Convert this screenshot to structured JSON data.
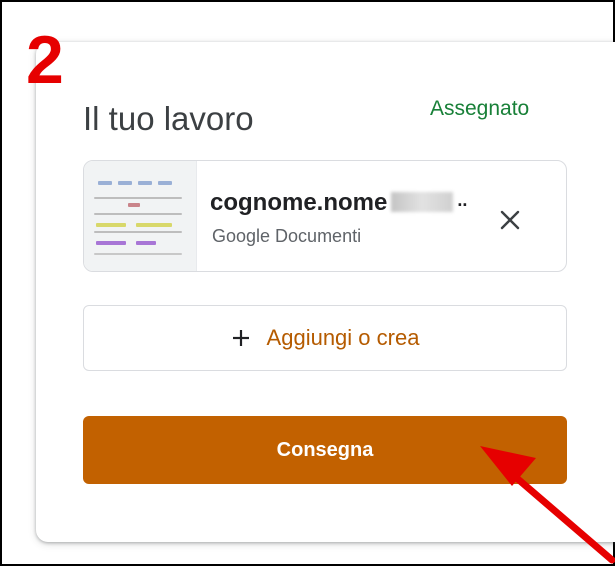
{
  "step": {
    "number": "2"
  },
  "card": {
    "title": "Il tuo lavoro",
    "status": "Assegnato"
  },
  "attachment": {
    "file_name": "cognome.nome",
    "file_type": "Google Documenti",
    "thumbnail_icon": "document-thumbnail",
    "remove_icon": "close-icon"
  },
  "actions": {
    "add_label": "Aggiungi o crea",
    "add_icon": "plus-icon",
    "submit_label": "Consegna"
  },
  "colors": {
    "step_number": "#e60000",
    "status": "#188038",
    "accent": "#c26100",
    "arrow": "#e60000"
  }
}
